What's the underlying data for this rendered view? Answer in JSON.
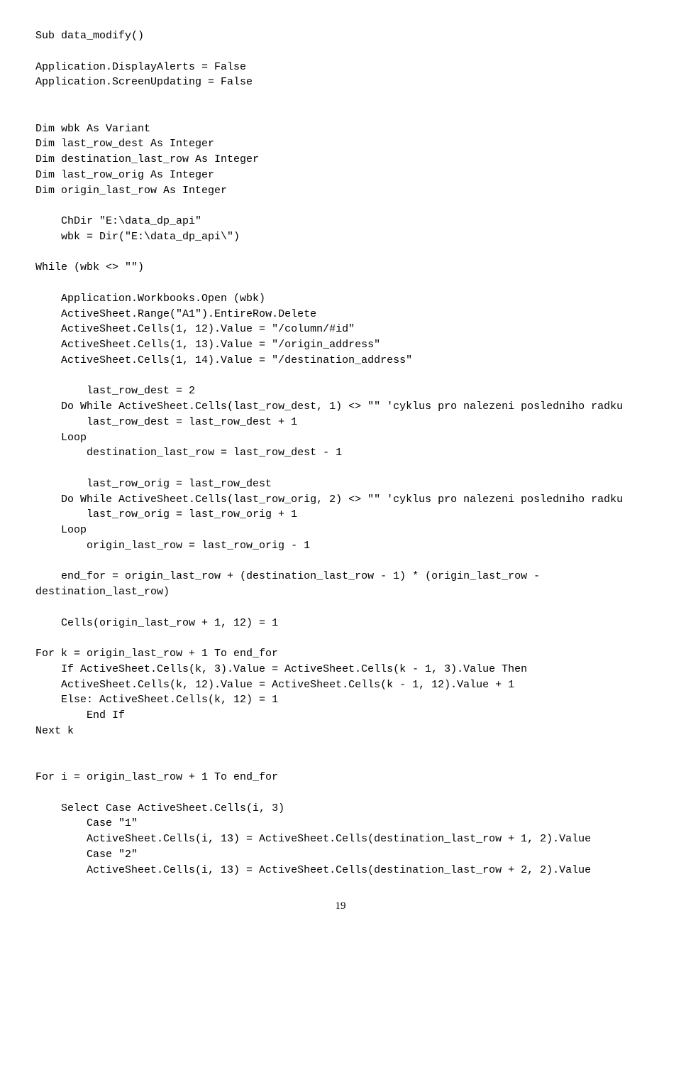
{
  "code": "Sub data_modify()\n\nApplication.DisplayAlerts = False\nApplication.ScreenUpdating = False\n\n\nDim wbk As Variant\nDim last_row_dest As Integer\nDim destination_last_row As Integer\nDim last_row_orig As Integer\nDim origin_last_row As Integer\n\n    ChDir \"E:\\data_dp_api\"\n    wbk = Dir(\"E:\\data_dp_api\\\")\n\nWhile (wbk <> \"\")\n\n    Application.Workbooks.Open (wbk)\n    ActiveSheet.Range(\"A1\").EntireRow.Delete\n    ActiveSheet.Cells(1, 12).Value = \"/column/#id\"\n    ActiveSheet.Cells(1, 13).Value = \"/origin_address\"\n    ActiveSheet.Cells(1, 14).Value = \"/destination_address\"\n\n        last_row_dest = 2\n    Do While ActiveSheet.Cells(last_row_dest, 1) <> \"\" 'cyklus pro nalezeni posledniho radku\n        last_row_dest = last_row_dest + 1\n    Loop\n        destination_last_row = last_row_dest - 1\n\n        last_row_orig = last_row_dest\n    Do While ActiveSheet.Cells(last_row_orig, 2) <> \"\" 'cyklus pro nalezeni posledniho radku\n        last_row_orig = last_row_orig + 1\n    Loop\n        origin_last_row = last_row_orig - 1\n\n    end_for = origin_last_row + (destination_last_row - 1) * (origin_last_row - destination_last_row)\n\n    Cells(origin_last_row + 1, 12) = 1\n\nFor k = origin_last_row + 1 To end_for\n    If ActiveSheet.Cells(k, 3).Value = ActiveSheet.Cells(k - 1, 3).Value Then\n    ActiveSheet.Cells(k, 12).Value = ActiveSheet.Cells(k - 1, 12).Value + 1\n    Else: ActiveSheet.Cells(k, 12) = 1\n        End If\nNext k\n\n\nFor i = origin_last_row + 1 To end_for\n\n    Select Case ActiveSheet.Cells(i, 3)\n        Case \"1\"\n        ActiveSheet.Cells(i, 13) = ActiveSheet.Cells(destination_last_row + 1, 2).Value\n        Case \"2\"\n        ActiveSheet.Cells(i, 13) = ActiveSheet.Cells(destination_last_row + 2, 2).Value",
  "pageNumber": "19"
}
